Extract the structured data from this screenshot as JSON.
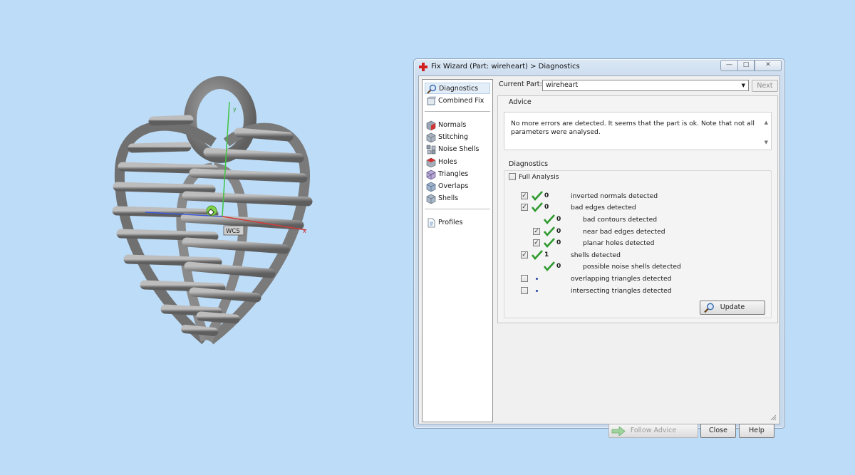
{
  "window": {
    "title": "Fix Wizard (Part: wireheart) > Diagnostics",
    "controls": {
      "minimize": "—",
      "maximize": "□",
      "close": "✕"
    }
  },
  "viewport": {
    "axis_label": "WCS"
  },
  "nav": {
    "items": [
      {
        "label": "Diagnostics",
        "icon": "magnifier-icon",
        "selected": true
      },
      {
        "label": "Combined Fix",
        "icon": "combined-fix-icon"
      },
      {
        "label": "Normals",
        "icon": "normals-cube-icon"
      },
      {
        "label": "Stitching",
        "icon": "stitching-cube-icon"
      },
      {
        "label": "Noise Shells",
        "icon": "noise-shells-icon"
      },
      {
        "label": "Holes",
        "icon": "holes-cube-icon"
      },
      {
        "label": "Triangles",
        "icon": "triangles-cube-icon"
      },
      {
        "label": "Overlaps",
        "icon": "overlaps-cube-icon"
      },
      {
        "label": "Shells",
        "icon": "shells-cube-icon"
      },
      {
        "label": "Profiles",
        "icon": "document-icon"
      }
    ]
  },
  "part": {
    "label": "Current Part:",
    "value": "wireheart",
    "next_label": "Next"
  },
  "advice": {
    "title": "Advice",
    "text": "No more errors are detected. It seems that the part is ok. Note that not all parameters were analysed."
  },
  "diagnostics": {
    "title": "Diagnostics",
    "full_analysis": {
      "label": "Full Analysis",
      "checked": false
    },
    "rows": [
      {
        "checked": true,
        "status": "ok",
        "count": "0",
        "label": "inverted normals detected"
      },
      {
        "checked": true,
        "status": "ok",
        "count": "0",
        "label": "bad edges detected"
      },
      {
        "checkbox": false,
        "status": "ok",
        "count": "0",
        "label": "bad contours detected"
      },
      {
        "checked": true,
        "status": "ok",
        "count": "0",
        "label": "near bad edges detected"
      },
      {
        "checked": true,
        "status": "ok",
        "count": "0",
        "label": "planar holes detected"
      },
      {
        "checked": true,
        "status": "ok",
        "count": "1",
        "label": "shells detected"
      },
      {
        "checkbox": false,
        "status": "ok",
        "count": "0",
        "label": "possible noise shells detected"
      },
      {
        "checked": false,
        "status": "none",
        "count": "",
        "label": "overlapping triangles detected"
      },
      {
        "checked": false,
        "status": "none",
        "count": "",
        "label": "intersecting triangles detected"
      }
    ],
    "update_label": "Update"
  },
  "buttons": {
    "follow_advice": "Follow Advice",
    "close": "Close",
    "help": "Help"
  },
  "colors": {
    "background": "#bddcf7",
    "check_green": "#2e9a2e",
    "model_gray": "#8a8a8a"
  }
}
